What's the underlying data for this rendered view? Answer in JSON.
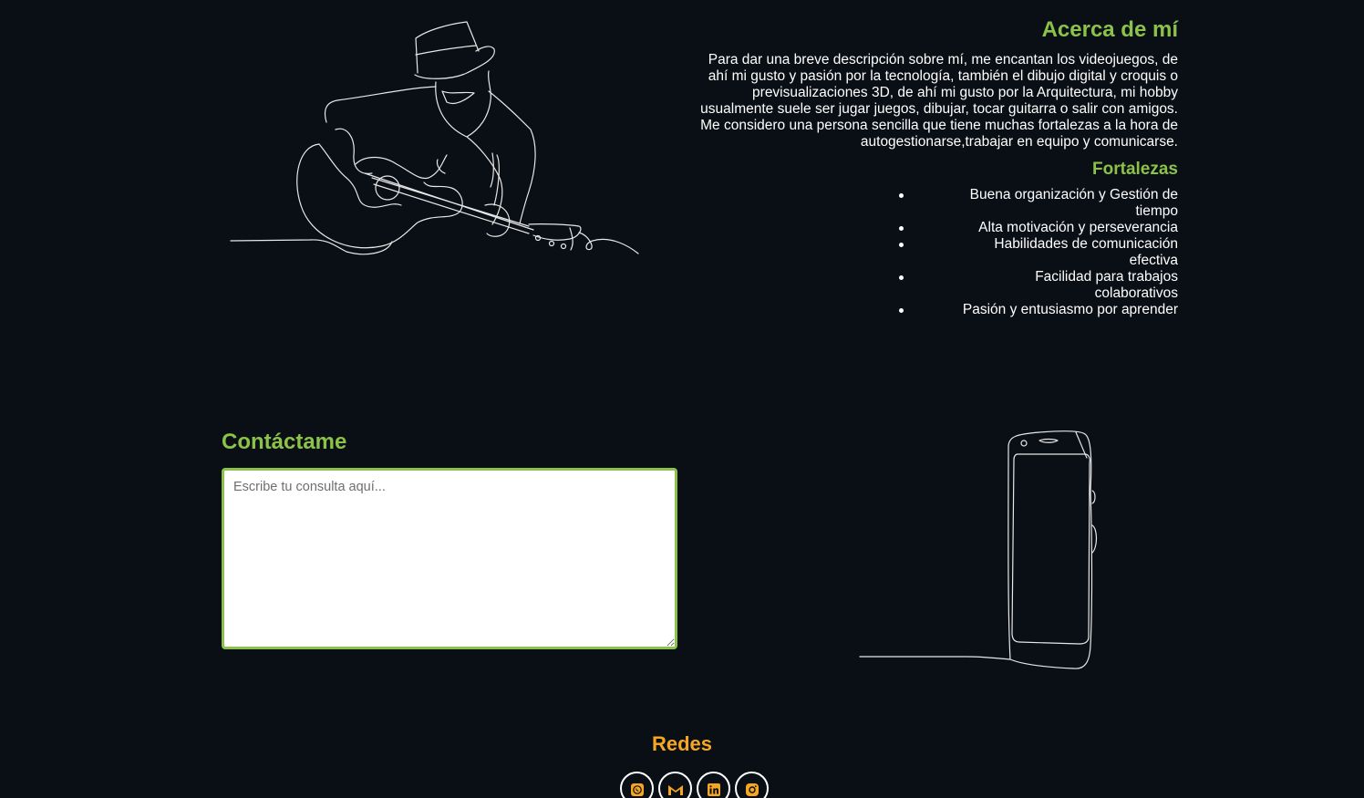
{
  "about": {
    "title": "Acerca de mí",
    "description": "Para dar una breve descripción sobre mí, me encantan los videojuegos, de ahí mi gusto y pasión por la tecnología, también el dibujo digital y croquis o previsualizaciones 3D, de ahí mi gusto por la Arquitectura, mi hobby usualmente suele ser jugar juegos, dibujar, tocar guitarra o salir con amigos. Me considero una persona sencilla que tiene muchas fortalezas a la hora de autogestionarse,trabajar en equipo y comunicarse.",
    "strengths_title": "Fortalezas",
    "strengths": [
      "Buena organización y Gestión de tiempo",
      "Alta motivación y perseverancia",
      "Habilidades de comunicación efectiva",
      "Facilidad para trabajos colaborativos",
      "Pasión y entusiasmo por aprender"
    ]
  },
  "contact": {
    "title": "Contáctame",
    "placeholder": "Escribe tu consulta aquí..."
  },
  "social": {
    "title": "Redes",
    "items": [
      "whatsapp-icon",
      "gmail-icon",
      "linkedin-icon",
      "instagram-icon"
    ]
  },
  "colors": {
    "background": "#0a0e15",
    "accent_green": "#8bc34a",
    "accent_orange": "#f5a623",
    "text": "#ffffff"
  }
}
